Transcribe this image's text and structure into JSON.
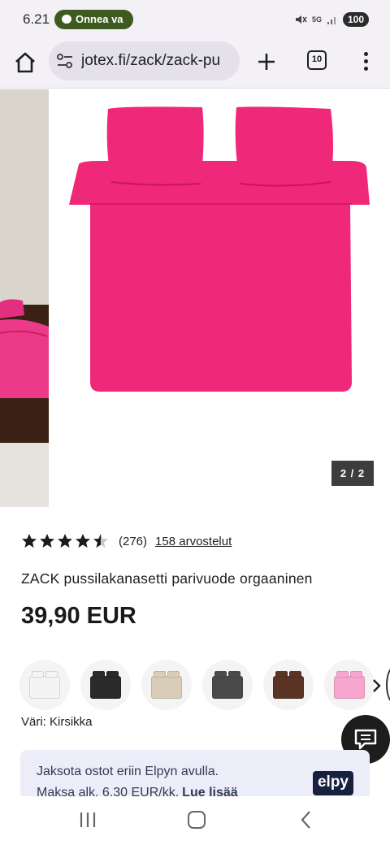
{
  "status_bar": {
    "time": "6.21",
    "notification": "Onnea va",
    "network": "5G",
    "battery": "100"
  },
  "browser": {
    "url": "jotex.fi/zack/zack-pu",
    "tab_count": "10"
  },
  "gallery": {
    "counter": "2 / 2",
    "product_color": "#f0287a"
  },
  "product": {
    "rating": 4.5,
    "rating_count": "(276)",
    "reviews_link": "158 arvostelut",
    "title": "ZACK pussilakanasetti parivuode orgaaninen",
    "price": "39,90 EUR",
    "colour_label": "Väri: Kirsikka"
  },
  "swatches": [
    {
      "name": "white",
      "color": "#f4f4f4"
    },
    {
      "name": "black",
      "color": "#2a2a2a"
    },
    {
      "name": "beige",
      "color": "#d9cdb8"
    },
    {
      "name": "grey",
      "color": "#4a4a4a"
    },
    {
      "name": "brown",
      "color": "#5a3526"
    },
    {
      "name": "pink",
      "color": "#f7a7cf"
    }
  ],
  "elpy": {
    "line1": "Jaksota ostot eriin Elpyn avulla.",
    "line2": "Maksa alk. 6,30 EUR/kk.",
    "more_link": "Lue lisää",
    "logo": "elpy"
  }
}
